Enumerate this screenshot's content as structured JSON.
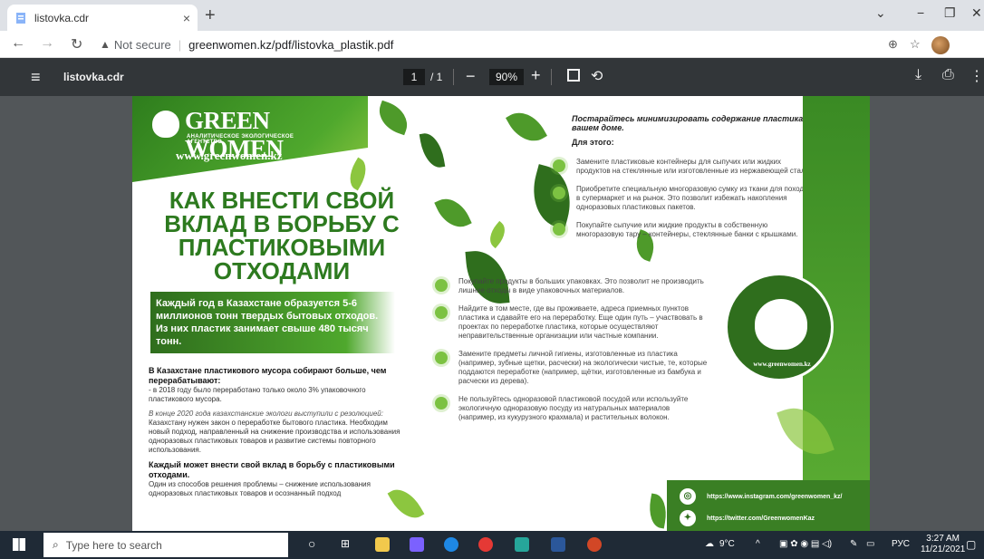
{
  "browser": {
    "tab_title": "listovka.cdr",
    "tab_close": "×",
    "new_tab": "+",
    "security_label": "Not secure",
    "url": "greenwomen.kz/pdf/listovka_plastik.pdf",
    "window_min": "−",
    "window_restore": "❐",
    "window_close": "✕",
    "chevron": "⌄"
  },
  "pdf_toolbar": {
    "title": "listovka.cdr",
    "page_current": "1",
    "page_total": "/ 1",
    "zoom": "90%",
    "zoom_minus": "−",
    "zoom_plus": "+"
  },
  "leaflet": {
    "logo_name": "GREEN WOMEN",
    "logo_sub": "АНАЛИТИЧЕСКОЕ ЭКОЛОГИЧЕСКОЕ АГЕНТСТВО",
    "site_url": "www.greenwomen.kz",
    "headline": "КАК ВНЕСТИ СВОЙ ВКЛАД В БОРЬБУ С ПЛАСТИКОВЫМИ ОТХОДАМИ",
    "fact_band": "Каждый год в Казахстане образуется 5-6 миллионов тонн твердых бытовых отходов. Из них пластик занимает свыше 480 тысяч тонн.",
    "left_heading": "В Казахстане пластикового мусора собирают больше, чем перерабатывают:",
    "left_p1": "- в 2018 году было переработано только около 3% упаковочного пластикового мусора.",
    "left_p2_italic": "В конце 2020 года казахстанские экологи выступили с резолюцией:",
    "left_p2": "Казахстану нужен закон о переработке бытового пластика. Необходим новый подход, направленный на снижение производства и использования одноразовых пластиковых товаров и развитие системы повторного использования.",
    "left_heading2": "Каждый может внести свой вклад в борьбу с пластиковыми отходами.",
    "left_p3": "Один из способов решения проблемы – снижение использования одноразовых пластиковых товаров и осознанный подход",
    "right_intro": "Постарайтесь минимизировать содержание пластика в вашем доме.",
    "right_for_this": "Для этого:",
    "bullets_right": [
      "Замените пластиковые контейнеры для сыпучих или жидких продуктов на стеклянные или изготовленные из нержавеющей стали.",
      "Приобретите специальную многоразовую сумку из ткани для походов в супермаркет и на рынок. Это позволит избежать накопления одноразовых пластиковых пакетов.",
      "Покупайте сыпучие или жидкие продукты в собственную многоразовую тару – контейнеры, стеклянные банки с крышками."
    ],
    "bullets_left": [
      "Покупайте продукты в больших упаковках. Это позволит не производить лишние отходы в виде упаковочных материалов.",
      "Найдите в том месте, где вы проживаете, адреса приемных пунктов пластика и сдавайте его на переработку. Еще один путь – участвовать в проектах по переработке пластика, которые осуществляют неправительственные организации или частные компании.",
      "Замените предметы личной гигиены, изготовленные из пластика (например, зубные щетки, расчески) на экологически чистые, те, которые поддаются переработке (например, щётки, изготовленные из бамбука и расчески из дерева).",
      "Не пользуйтесь одноразовой пластиковой посудой или используйте экологичную одноразовую посуду из натуральных материалов (например, из кукурузного крахмала) и растительных волокон."
    ],
    "circle_url": "www.greenwomen.kz",
    "instagram": "https://www.instagram.com/greenwomen_kz/",
    "twitter": "https://twitter.com/GreenwomenKaz"
  },
  "taskbar": {
    "search_placeholder": "Type here to search",
    "weather": "9°C",
    "lang": "РУС",
    "time": "3:27 AM",
    "date": "11/21/2021"
  }
}
